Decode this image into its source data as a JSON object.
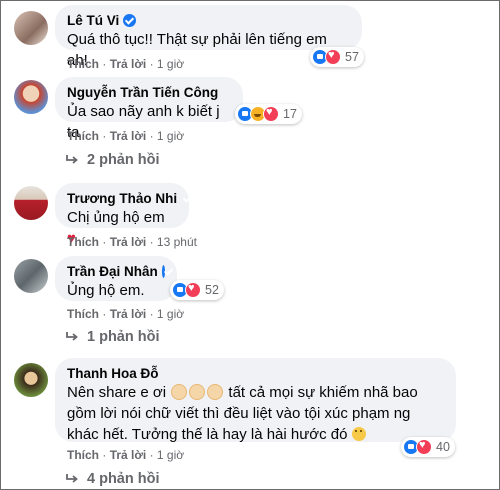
{
  "comments": [
    {
      "name": "Lê Tú Vi",
      "text": "Quá thô tục!! Thật sự phải lên tiếng em ah!",
      "reactions": [
        "like",
        "love"
      ],
      "reaction_count": "57",
      "like_label": "Thích",
      "reply_label": "Trả lời",
      "time": "1 giờ",
      "sep": "·"
    },
    {
      "name": "Nguyễn Trần Tiến Công",
      "text": "Ủa sao nãy anh k biết j ta",
      "reactions": [
        "like",
        "haha",
        "love"
      ],
      "reaction_count": "17",
      "like_label": "Thích",
      "reply_label": "Trả lời",
      "time": "1 giờ",
      "sep": "·",
      "replies": "2 phản hồi"
    },
    {
      "name": "Trương Thảo Nhi",
      "text": "Chị ủng hộ em",
      "text_emoji": "♥",
      "like_label": "Thích",
      "reply_label": "Trả lời",
      "time": "13 phút",
      "sep": "·"
    },
    {
      "name": "Trần Đại Nhân",
      "text": "Ủng hộ em.",
      "reactions": [
        "like",
        "love"
      ],
      "reaction_count": "52",
      "like_label": "Thích",
      "reply_label": "Trả lời",
      "time": "1 giờ",
      "sep": "·",
      "replies": "1 phản hồi"
    },
    {
      "name": "Thanh Hoa Đỗ",
      "text_line1_a": "Nên share e ơi",
      "text_line1_b": "tất cả mọi sự khiếm nhã bao",
      "text_line2": "gồm lời nói chữ viết thì đều liệt vào tội xúc phạm ng",
      "text_line3": "khác hết. Tưởng thế là hay là hài hước đó",
      "reactions": [
        "like",
        "love"
      ],
      "reaction_count": "40",
      "like_label": "Thích",
      "reply_label": "Trả lời",
      "time": "1 giờ",
      "sep": "·",
      "replies": "4 phản hồi"
    }
  ],
  "colors": {
    "bubble": "#f0f2f5",
    "secondary_text": "#65676b",
    "verified": "#1877f2",
    "like": "#1877f2",
    "love": "#f33e58"
  },
  "icons": [
    "verified-badge-icon",
    "like-reaction-icon",
    "love-reaction-icon",
    "haha-reaction-icon",
    "reply-arrow-icon",
    "heart-emoji-icon",
    "clap-emoji-icon",
    "sad-emoji-icon"
  ]
}
